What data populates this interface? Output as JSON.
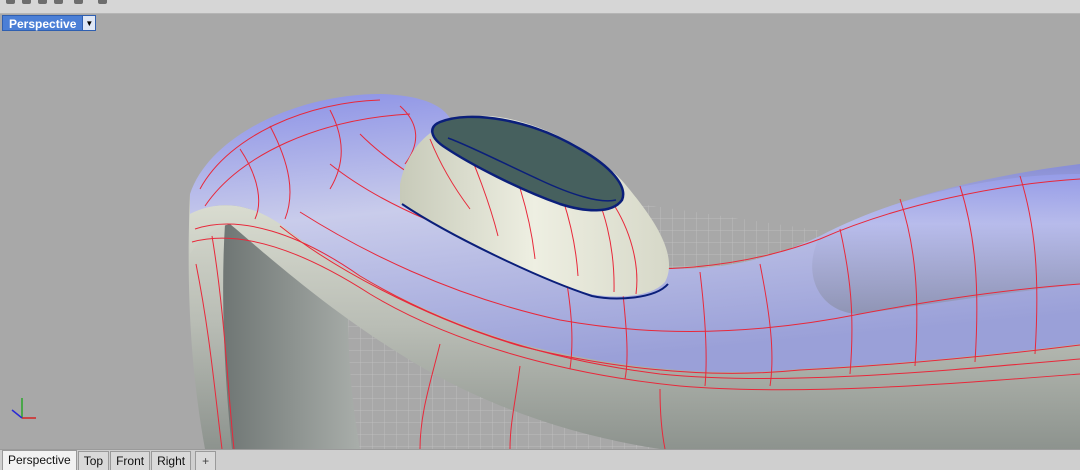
{
  "viewport": {
    "title": "Perspective",
    "menu_icon": "dropdown-arrow-icon",
    "axis_widget": "xyz-axis-icon"
  },
  "tabs": [
    {
      "label": "Perspective",
      "active": true
    },
    {
      "label": "Top",
      "active": false
    },
    {
      "label": "Front",
      "active": false
    },
    {
      "label": "Right",
      "active": false
    }
  ],
  "add_tab_icon": "plus-icon",
  "colors": {
    "viewport_bg": "#a8a8a8",
    "title_bg": "#4b7fd6",
    "isocurve": "#e8283a",
    "edge": "#0b1f7a",
    "surface_highlight": "#8f96e8"
  }
}
